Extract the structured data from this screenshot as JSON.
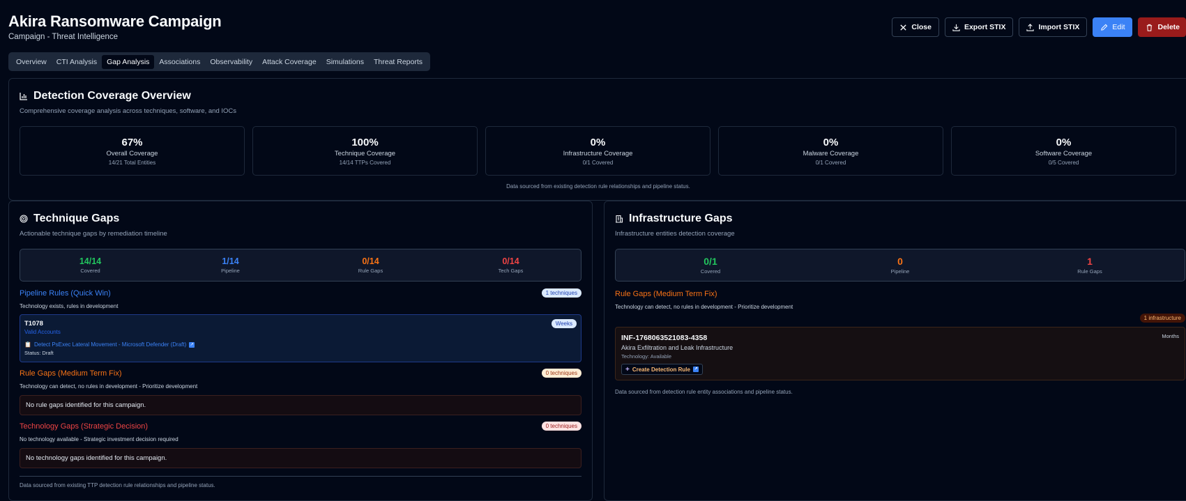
{
  "header": {
    "title": "Akira Ransomware Campaign",
    "subtitle": "Campaign - Threat Intelligence"
  },
  "actions": {
    "close": "Close",
    "export": "Export STIX",
    "import": "Import STIX",
    "edit": "Edit",
    "delete": "Delete"
  },
  "tabs": [
    "Overview",
    "CTI Analysis",
    "Gap Analysis",
    "Associations",
    "Observability",
    "Attack Coverage",
    "Simulations",
    "Threat Reports"
  ],
  "active_tab": "Gap Analysis",
  "overview": {
    "title": "Detection Coverage Overview",
    "description": "Comprehensive coverage analysis across techniques, software, and IOCs",
    "stats": [
      {
        "value": "67%",
        "label": "Overall Coverage",
        "sub": "14/21 Total Entities"
      },
      {
        "value": "100%",
        "label": "Technique Coverage",
        "sub": "14/14 TTPs Covered"
      },
      {
        "value": "0%",
        "label": "Infrastructure Coverage",
        "sub": "0/1 Covered"
      },
      {
        "value": "0%",
        "label": "Malware Coverage",
        "sub": "0/1 Covered"
      },
      {
        "value": "0%",
        "label": "Software Coverage",
        "sub": "0/5 Covered"
      }
    ],
    "footnote": "Data sourced from existing detection rule relationships and pipeline status."
  },
  "technique_gaps": {
    "title": "Technique Gaps",
    "description": "Actionable technique gaps by remediation timeline",
    "stats": [
      {
        "value": "14/14",
        "label": "Covered"
      },
      {
        "value": "1/14",
        "label": "Pipeline"
      },
      {
        "value": "0/14",
        "label": "Rule Gaps"
      },
      {
        "value": "0/14",
        "label": "Tech Gaps"
      }
    ],
    "pipeline": {
      "title": "Pipeline Rules (Quick Win)",
      "badge": "1 techniques",
      "description": "Technology exists, rules in development",
      "item": {
        "id": "T1078",
        "name": "Valid Accounts",
        "timeline": "Weeks",
        "rule": "Detect PsExec Lateral Movement - Microsoft Defender (Draft)",
        "status": "Status: Draft"
      }
    },
    "rule_gaps": {
      "title": "Rule Gaps (Medium Term Fix)",
      "badge": "0 techniques",
      "description": "Technology can detect, no rules in development - Prioritize development",
      "empty": "No rule gaps identified for this campaign."
    },
    "tech_gaps": {
      "title": "Technology Gaps (Strategic Decision)",
      "badge": "0 techniques",
      "description": "No technology available - Strategic investment decision required",
      "empty": "No technology gaps identified for this campaign."
    },
    "footnote": "Data sourced from existing TTP detection rule relationships and pipeline status."
  },
  "infrastructure_gaps": {
    "title": "Infrastructure Gaps",
    "description": "Infrastructure entities detection coverage",
    "stats": [
      {
        "value": "0/1",
        "label": "Covered"
      },
      {
        "value": "0",
        "label": "Pipeline"
      },
      {
        "value": "1",
        "label": "Rule Gaps"
      }
    ],
    "rule_gaps": {
      "title": "Rule Gaps (Medium Term Fix)",
      "description": "Technology can detect, no rules in development - Prioritize development",
      "badge": "1 infrastructure",
      "item": {
        "id": "INF-1768063521083-4358",
        "name": "Akira Exfiltration and Leak Infrastructure",
        "tech": "Technology: Available",
        "timeline": "Months",
        "button": "Create Detection Rule"
      }
    },
    "footnote": "Data sourced from detection rule entity associations and pipeline status."
  }
}
